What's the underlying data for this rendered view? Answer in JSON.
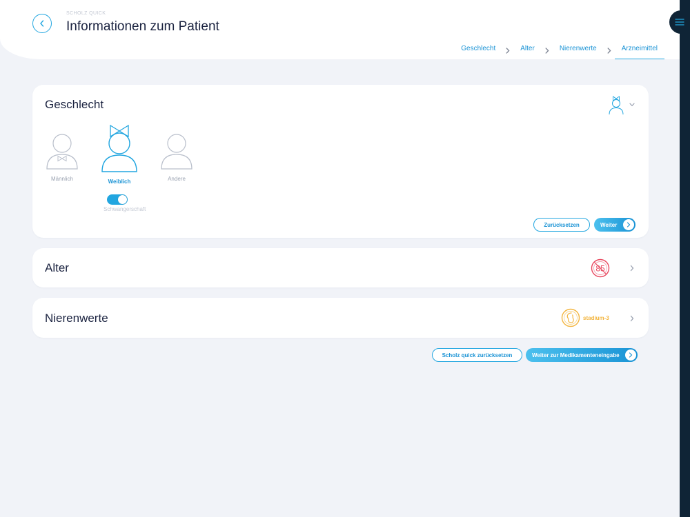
{
  "header": {
    "brand": "SCHOLZ QUICK",
    "title": "Informationen zum Patient",
    "steps": [
      "Geschlecht",
      "Alter",
      "Nierenwerte",
      "Arzneimittel"
    ]
  },
  "gender_card": {
    "title": "Geschlecht",
    "options": [
      {
        "label": "Männlich",
        "selected": false
      },
      {
        "label": "Weiblich",
        "selected": true
      },
      {
        "label": "Andere",
        "selected": false
      }
    ],
    "pregnancy_toggle": {
      "label": "Schwangerschaft",
      "on": true
    },
    "reset_label": "Zurücksetzen",
    "next_label": "Weiter"
  },
  "age_card": {
    "title": "Alter",
    "value": "85"
  },
  "kidney_card": {
    "title": "Nierenwerte",
    "stage": "stadium-3"
  },
  "footer": {
    "reset_all_label": "Scholz quick zurücksetzen",
    "continue_label": "Weiter zur Medikamenteneingabe"
  },
  "colors": {
    "accent": "#22a6e0",
    "age_badge": "#e8485f",
    "kidney_badge": "#f3b53f"
  }
}
